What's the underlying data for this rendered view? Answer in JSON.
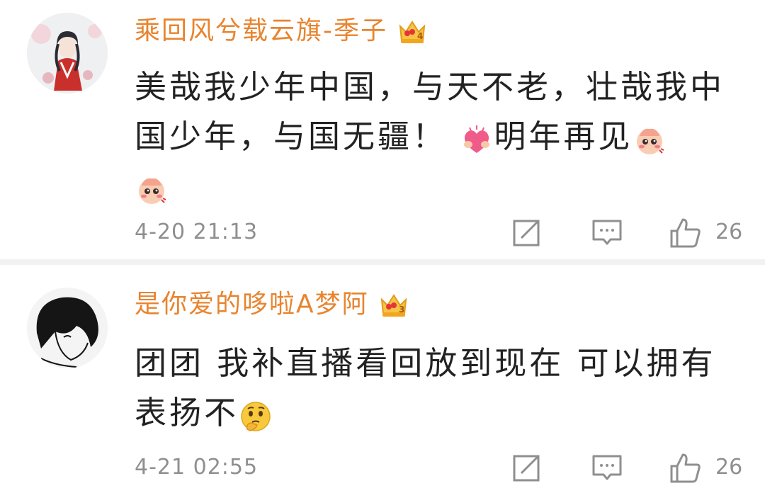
{
  "comments": [
    {
      "username": "乘回风兮载云旗-季子",
      "level": "4",
      "text_parts": [
        "美哉我少年中国，与天不老，壮哉我中国少年，与国无疆！",
        "明年再见"
      ],
      "emoji": [
        "heart-hug-emoji",
        "shy-face-emoji",
        "shy-face-emoji"
      ],
      "time": "4-20 21:13",
      "likes": "26"
    },
    {
      "username": "是你爱的哆啦A梦阿",
      "level": "3",
      "text_parts": [
        "团团 我补直播看回放到现在 可以拥有表扬不"
      ],
      "emoji": [
        "thinking-face-emoji"
      ],
      "time": "4-21 02:55",
      "likes": "26"
    }
  ],
  "colors": {
    "username": "#e8842f",
    "meta": "#8f8f8f",
    "text": "#222222",
    "separator": "#f2f2f2"
  }
}
